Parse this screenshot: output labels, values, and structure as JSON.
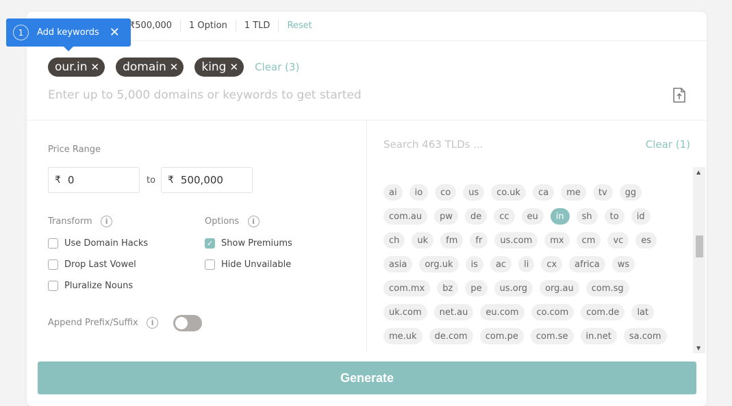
{
  "summary": {
    "price": "₹500,000",
    "options": "1 Option",
    "tld": "1 TLD",
    "reset": "Reset"
  },
  "tooltip": {
    "step": "1",
    "label": "Add keywords",
    "close": "✕"
  },
  "keywords": {
    "items": [
      "our.in",
      "domain",
      "king"
    ],
    "clear": "Clear (3)",
    "placeholder": "Enter up to 5,000 domains or keywords to get started"
  },
  "price_range": {
    "label": "Price Range",
    "currency": "₹",
    "min": "0",
    "to": "to",
    "max": "500,000"
  },
  "transform": {
    "label": "Transform",
    "items": [
      {
        "label": "Use Domain Hacks",
        "checked": false
      },
      {
        "label": "Drop Last Vowel",
        "checked": false
      },
      {
        "label": "Pluralize Nouns",
        "checked": false
      }
    ]
  },
  "options": {
    "label": "Options",
    "items": [
      {
        "label": "Show Premiums",
        "checked": true
      },
      {
        "label": "Hide Unvailable",
        "checked": false
      }
    ]
  },
  "append": {
    "label": "Append Prefix/Suffix",
    "enabled": false
  },
  "tld_panel": {
    "search_placeholder": "Search 463 TLDs ...",
    "clear": "Clear (1)",
    "selected": "in",
    "tlds": [
      "ai",
      "io",
      "co",
      "us",
      "co.uk",
      "ca",
      "me",
      "tv",
      "gg",
      "com.au",
      "pw",
      "de",
      "cc",
      "eu",
      "in",
      "sh",
      "to",
      "id",
      "ch",
      "uk",
      "fm",
      "fr",
      "us.com",
      "mx",
      "cm",
      "vc",
      "es",
      "asia",
      "org.uk",
      "is",
      "ac",
      "li",
      "cx",
      "africa",
      "ws",
      "com.mx",
      "bz",
      "pe",
      "us.org",
      "org.au",
      "com.sg",
      "uk.com",
      "net.au",
      "eu.com",
      "co.com",
      "com.de",
      "lat",
      "me.uk",
      "de.com",
      "com.pe",
      "com.se",
      "in.net",
      "sa.com"
    ]
  },
  "generate": "Generate",
  "colors": {
    "accent": "#8ac1bf",
    "tooltip": "#2f80e4",
    "chip": "#4a4541"
  }
}
